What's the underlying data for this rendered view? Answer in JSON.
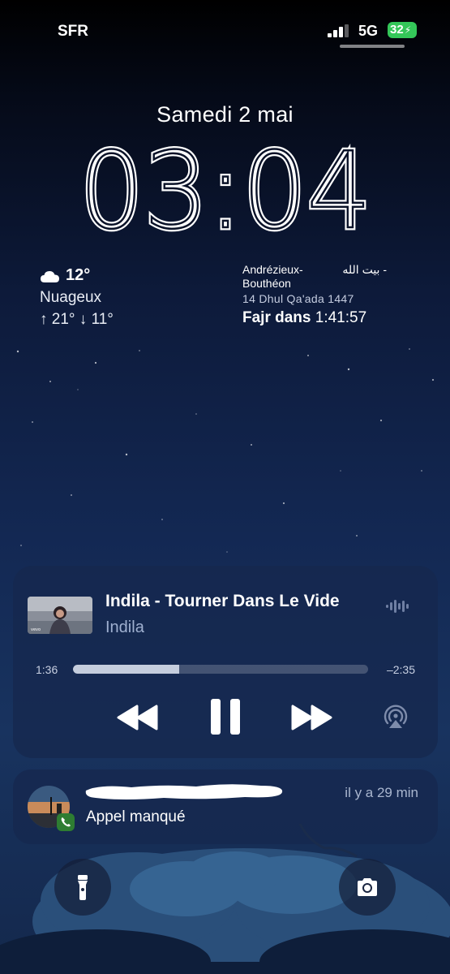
{
  "status_bar": {
    "carrier": "SFR",
    "network": "5G",
    "battery_level": "32",
    "battery_color": "#34c759"
  },
  "lock_screen": {
    "date": "Samedi 2 mai",
    "time": "03:04"
  },
  "weather_widget": {
    "icon": "cloud-icon",
    "temperature": "12°",
    "condition": "Nuageux",
    "high_low": "↑ 21° ↓ 11°"
  },
  "prayer_widget": {
    "location_line1": "Andrézieux-",
    "arabic": "- بيت الله",
    "location_line2": "Bouthéon",
    "hijri_date": "14 Dhul Qa'ada 1447",
    "next_prayer": "Fajr dans",
    "countdown": "1:41:57"
  },
  "now_playing": {
    "title": "Indila - Tourner Dans Le Vide",
    "artist": "Indila",
    "elapsed": "1:36",
    "remaining": "–2:35",
    "progress": 0.36,
    "controls": [
      "rewind-icon",
      "pause-icon",
      "forward-icon",
      "airplay-icon"
    ]
  },
  "notification": {
    "time": "il y a 29 min",
    "message": "Appel manqué",
    "app_icon": "phone-icon"
  },
  "quick_actions": [
    "flashlight-icon",
    "camera-icon"
  ]
}
